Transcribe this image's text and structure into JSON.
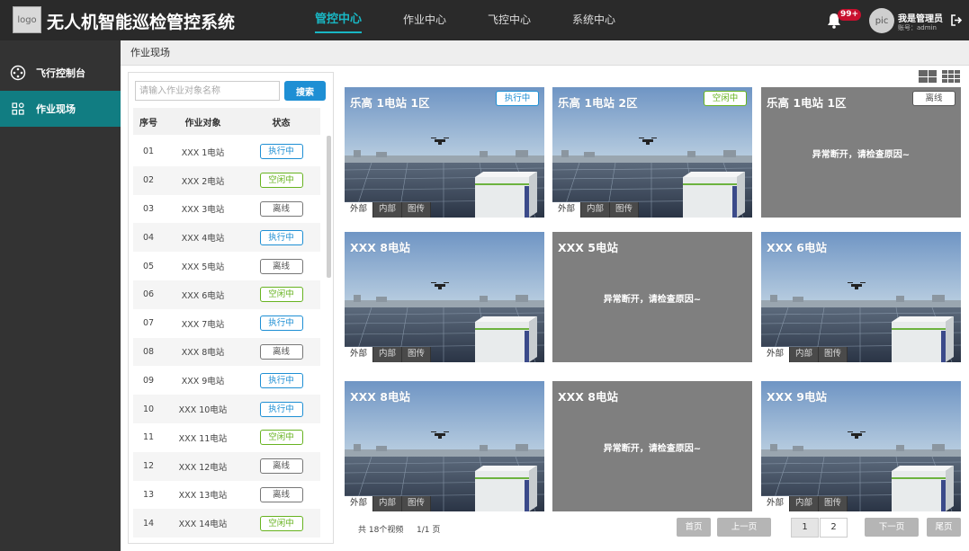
{
  "header": {
    "logo_text": "logo",
    "title": "无人机智能巡检管控系统",
    "nav": [
      {
        "label": "管控中心",
        "active": true
      },
      {
        "label": "作业中心",
        "active": false
      },
      {
        "label": "飞控中心",
        "active": false
      },
      {
        "label": "系统中心",
        "active": false
      }
    ],
    "notification_count": "99+",
    "avatar_text": "pic",
    "user_name": "我是管理员",
    "user_account": "账号：admin"
  },
  "sidebar": {
    "items": [
      {
        "label": "飞行控制台",
        "icon": "joystick-icon",
        "active": false
      },
      {
        "label": "作业现场",
        "icon": "grid-icon",
        "active": true
      }
    ]
  },
  "breadcrumb": "作业现场",
  "search": {
    "placeholder": "请输入作业对象名称",
    "button": "搜索"
  },
  "table": {
    "headers": [
      "序号",
      "作业对象",
      "状态"
    ],
    "rows": [
      {
        "no": "01",
        "name": "XXX 1电站",
        "status": "执行中",
        "type": "exec"
      },
      {
        "no": "02",
        "name": "XXX 2电站",
        "status": "空闲中",
        "type": "idle"
      },
      {
        "no": "03",
        "name": "XXX 3电站",
        "status": "离线",
        "type": "off"
      },
      {
        "no": "04",
        "name": "XXX 4电站",
        "status": "执行中",
        "type": "exec"
      },
      {
        "no": "05",
        "name": "XXX 5电站",
        "status": "离线",
        "type": "off"
      },
      {
        "no": "06",
        "name": "XXX 6电站",
        "status": "空闲中",
        "type": "idle"
      },
      {
        "no": "07",
        "name": "XXX 7电站",
        "status": "执行中",
        "type": "exec"
      },
      {
        "no": "08",
        "name": "XXX 8电站",
        "status": "离线",
        "type": "off"
      },
      {
        "no": "09",
        "name": "XXX 9电站",
        "status": "执行中",
        "type": "exec"
      },
      {
        "no": "10",
        "name": "XXX 10电站",
        "status": "执行中",
        "type": "exec"
      },
      {
        "no": "11",
        "name": "XXX 11电站",
        "status": "空闲中",
        "type": "idle"
      },
      {
        "no": "12",
        "name": "XXX 12电站",
        "status": "离线",
        "type": "off"
      },
      {
        "no": "13",
        "name": "XXX 13电站",
        "status": "离线",
        "type": "off"
      },
      {
        "no": "14",
        "name": "XXX 14电站",
        "status": "空闲中",
        "type": "idle"
      }
    ]
  },
  "tiles": [
    {
      "title": "乐高 1电站 1区",
      "badge": "执行中",
      "badge_type": "exec",
      "online": true
    },
    {
      "title": "乐高 1电站 2区",
      "badge": "空闲中",
      "badge_type": "idle",
      "online": true
    },
    {
      "title": "乐高 1电站 1区",
      "badge": "离线",
      "badge_type": "off",
      "online": false,
      "message": "异常断开，请检查原因~"
    },
    {
      "title": "XXX 8电站",
      "online": true
    },
    {
      "title": "XXX 5电站",
      "online": false,
      "message": "异常断开，请检查原因~"
    },
    {
      "title": "XXX 6电站",
      "online": true
    },
    {
      "title": "XXX 8电站",
      "online": true
    },
    {
      "title": "XXX 8电站",
      "online": false,
      "message": "异常断开，请检查原因~"
    },
    {
      "title": "XXX 9电站",
      "online": true
    }
  ],
  "camera_tabs": [
    "外部",
    "内部",
    "图传"
  ],
  "pagination": {
    "total": "共 18个视频",
    "pages": "1/1 页",
    "first": "首页",
    "prev": "上一页",
    "page_numbers": [
      "1",
      "2"
    ],
    "next": "下一页",
    "last": "尾页"
  },
  "colors": {
    "exec": "#1e8fd4",
    "idle": "#67b320",
    "off": "#777777",
    "accent": "#19b7c4",
    "sidebar_active": "#117d82"
  }
}
